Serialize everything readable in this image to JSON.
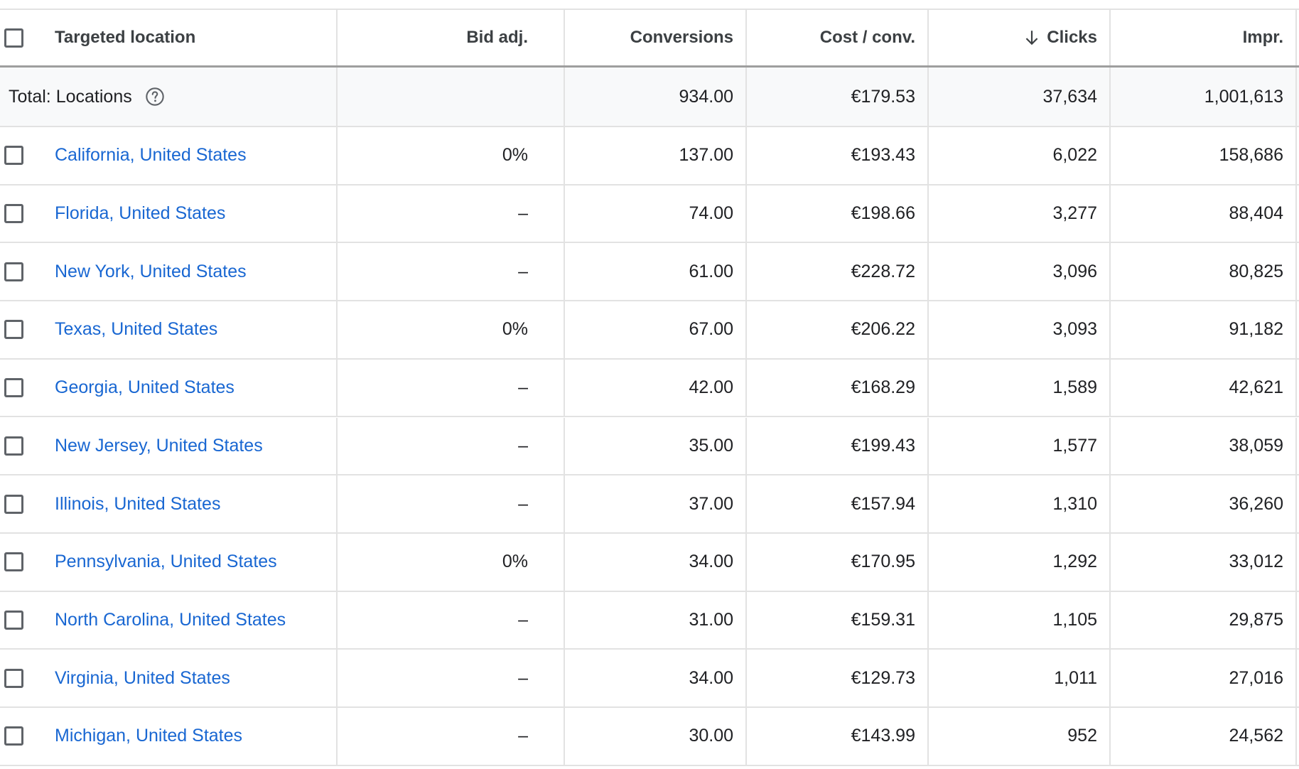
{
  "table": {
    "columns": {
      "location": "Targeted location",
      "bid_adj": "Bid adj.",
      "conversions": "Conversions",
      "cost_per_conv": "Cost / conv.",
      "clicks": "Clicks",
      "impr": "Impr."
    },
    "sorted_column": "clicks",
    "sort_direction": "descending",
    "total": {
      "label": "Total: Locations",
      "conversions": "934.00",
      "cost_per_conv": "€179.53",
      "clicks": "37,634",
      "impr": "1,001,613"
    },
    "rows": [
      {
        "location": "California, United States",
        "bid_adj": "0%",
        "conversions": "137.00",
        "cost_per_conv": "€193.43",
        "clicks": "6,022",
        "impr": "158,686"
      },
      {
        "location": "Florida, United States",
        "bid_adj": "–",
        "conversions": "74.00",
        "cost_per_conv": "€198.66",
        "clicks": "3,277",
        "impr": "88,404"
      },
      {
        "location": "New York, United States",
        "bid_adj": "–",
        "conversions": "61.00",
        "cost_per_conv": "€228.72",
        "clicks": "3,096",
        "impr": "80,825"
      },
      {
        "location": "Texas, United States",
        "bid_adj": "0%",
        "conversions": "67.00",
        "cost_per_conv": "€206.22",
        "clicks": "3,093",
        "impr": "91,182"
      },
      {
        "location": "Georgia, United States",
        "bid_adj": "–",
        "conversions": "42.00",
        "cost_per_conv": "€168.29",
        "clicks": "1,589",
        "impr": "42,621"
      },
      {
        "location": "New Jersey, United States",
        "bid_adj": "–",
        "conversions": "35.00",
        "cost_per_conv": "€199.43",
        "clicks": "1,577",
        "impr": "38,059"
      },
      {
        "location": "Illinois, United States",
        "bid_adj": "–",
        "conversions": "37.00",
        "cost_per_conv": "€157.94",
        "clicks": "1,310",
        "impr": "36,260"
      },
      {
        "location": "Pennsylvania, United States",
        "bid_adj": "0%",
        "conversions": "34.00",
        "cost_per_conv": "€170.95",
        "clicks": "1,292",
        "impr": "33,012"
      },
      {
        "location": "North Carolina, United States",
        "bid_adj": "–",
        "conversions": "31.00",
        "cost_per_conv": "€159.31",
        "clicks": "1,105",
        "impr": "29,875"
      },
      {
        "location": "Virginia, United States",
        "bid_adj": "–",
        "conversions": "34.00",
        "cost_per_conv": "€129.73",
        "clicks": "1,011",
        "impr": "27,016"
      },
      {
        "location": "Michigan, United States",
        "bid_adj": "–",
        "conversions": "30.00",
        "cost_per_conv": "€143.99",
        "clicks": "952",
        "impr": "24,562"
      }
    ]
  },
  "colors": {
    "link": "#1967d2",
    "text": "#202124",
    "border": "#e2e2e2",
    "total_bg": "#f8f9fa"
  },
  "icons": {
    "help": "help-circle-icon",
    "sort": "arrow-down-icon"
  }
}
